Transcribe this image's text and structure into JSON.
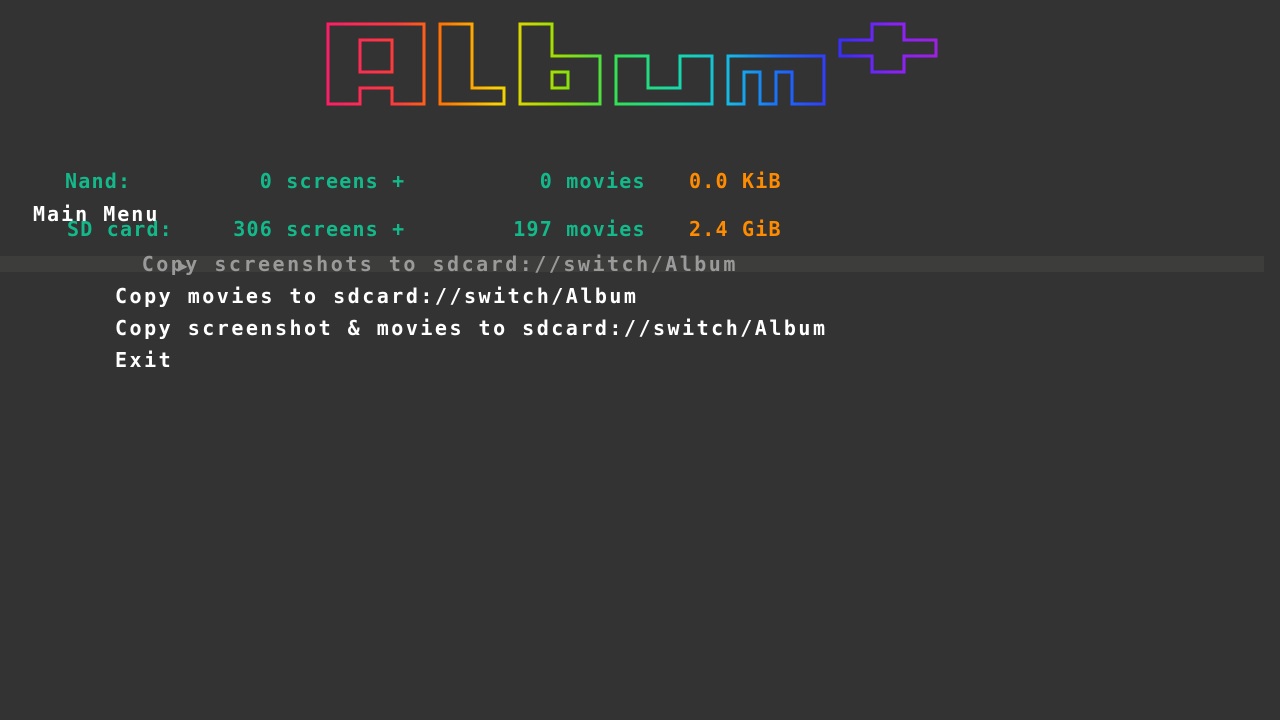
{
  "logo": {
    "text": "Album+"
  },
  "stats": [
    {
      "label": "Nand:",
      "screens": "0",
      "mid": " screens + ",
      "movies": "0",
      "mlabel": " movies",
      "size": "0.0 KiB"
    },
    {
      "label": "SD card:",
      "screens": "306",
      "mid": " screens + ",
      "movies": "197",
      "mlabel": " movies",
      "size": "2.4 GiB"
    }
  ],
  "menu": {
    "title": "Main Menu",
    "cursor_icon": "play-triangle-icon",
    "items": [
      {
        "label": "Copy screenshots to sdcard://switch/Album"
      },
      {
        "label": "Copy movies to sdcard://switch/Album"
      },
      {
        "label": "Copy screenshot & movies to sdcard://switch/Album"
      },
      {
        "label": "Exit"
      }
    ],
    "selected_index": 0
  },
  "colors": {
    "background": "#333333",
    "stats_text": "#13b98a",
    "size_text": "#ff8c00",
    "menu_text": "#ffffff",
    "selected_text": "#9a9a9a",
    "selected_bar": "#3d3d3b"
  }
}
